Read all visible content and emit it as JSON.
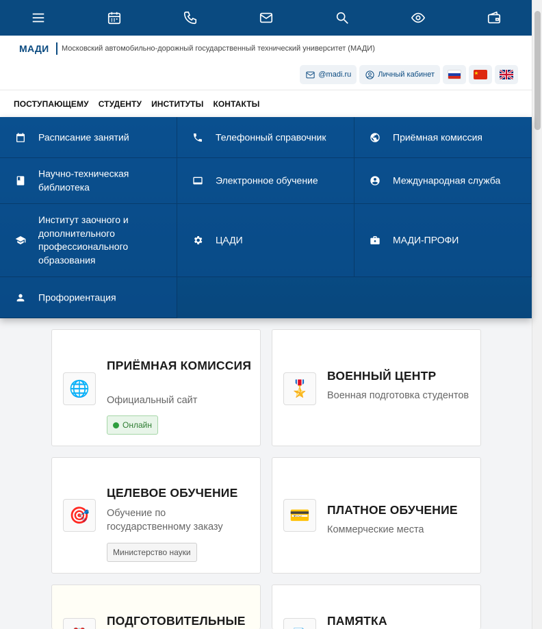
{
  "topbar": {
    "icons": [
      "menu-icon",
      "calendar-icon",
      "phone-icon",
      "mail-icon",
      "search-icon",
      "eye-icon",
      "wallet-icon"
    ]
  },
  "header": {
    "brand": "МАДИ",
    "full_name": "Московский автомобильно-дорожный государственный технический университет (МАДИ)",
    "mail_link": "@madi.ru",
    "cabinet_link": "Личный кабинет",
    "flags": [
      "russia-flag-icon",
      "china-flag-icon",
      "uk-flag-icon"
    ]
  },
  "nav": {
    "items": [
      "ПОСТУПАЮЩЕМУ",
      "СТУДЕНТУ",
      "ИНСТИТУТЫ",
      "КОНТАКТЫ"
    ]
  },
  "menu": {
    "items": [
      {
        "label": "Расписание занятий",
        "icon": "calendar-icon"
      },
      {
        "label": "Телефонный справочник",
        "icon": "phone-icon"
      },
      {
        "label": "Приёмная комиссия",
        "icon": "globe-icon"
      },
      {
        "label": "Научно-техническая библиотека",
        "icon": "book-icon"
      },
      {
        "label": "Электронное обучение",
        "icon": "laptop-icon"
      },
      {
        "label": "Международная служба",
        "icon": "face-icon"
      },
      {
        "label": "Институт заочного и дополнительного профессионального образования",
        "icon": "graduation-cap-icon"
      },
      {
        "label": "ЦАДИ",
        "icon": "gear-icon"
      },
      {
        "label": "МАДИ-ПРОФИ",
        "icon": "briefcase-icon"
      },
      {
        "label": "Профориентация",
        "icon": "person-icon"
      }
    ]
  },
  "cards": [
    {
      "title": "ПРИЁМНАЯ КОМИССИЯ",
      "subtitle": "Официальный сайт",
      "badge": "Онлайн",
      "icon": "globe-emoji-icon"
    },
    {
      "title": "ВОЕННЫЙ ЦЕНТР",
      "subtitle": "Военная подготовка студентов",
      "icon": "medal-icon"
    },
    {
      "title": "ЦЕЛЕВОЕ ОБУЧЕНИЕ",
      "subtitle": "Обучение по государственному заказу",
      "badge": "Министерство науки",
      "icon": "target-icon"
    },
    {
      "title": "ПЛАТНОЕ ОБУЧЕНИЕ",
      "subtitle": "Коммерческие места",
      "icon": "credit-card-icon"
    },
    {
      "title": "ПОДГОТОВИТЕЛЬНЫЕ",
      "icon": "clock-icon"
    },
    {
      "title": "ПАМЯТКА",
      "icon": "document-icon"
    }
  ],
  "colors": {
    "primary": "#0a4a80",
    "menu_bg": "#0b5594",
    "online_green": "#2e9e3e"
  }
}
